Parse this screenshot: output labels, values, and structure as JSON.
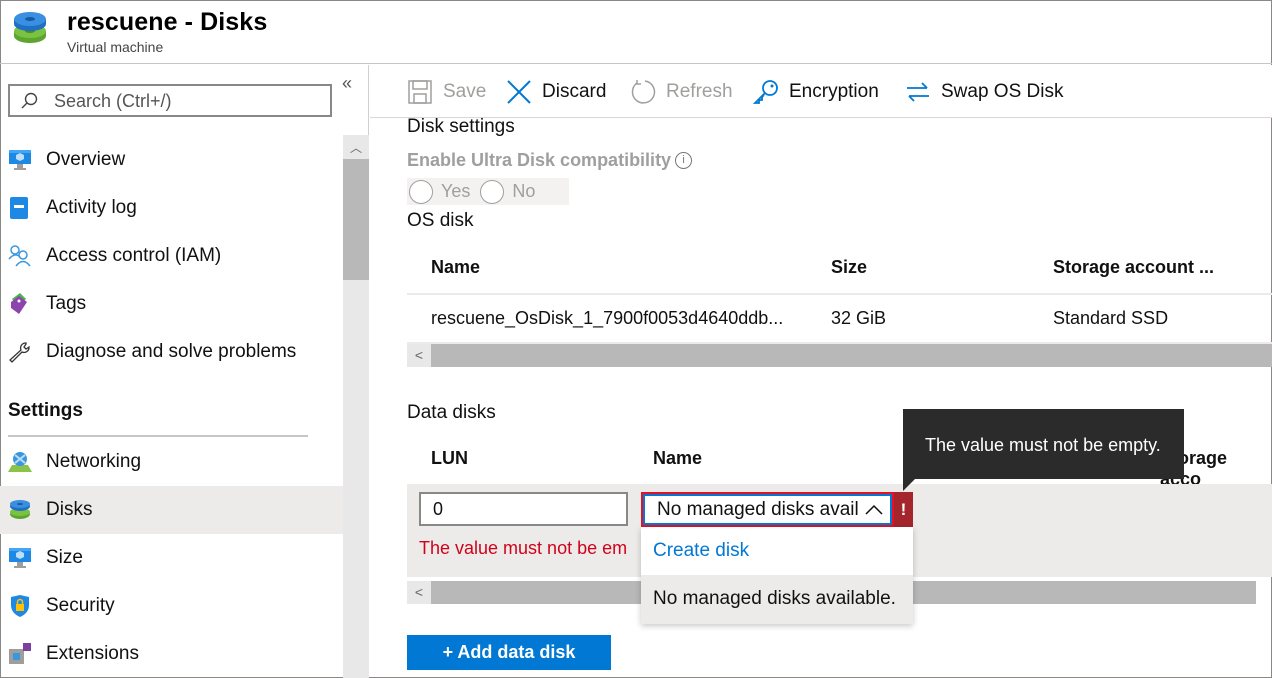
{
  "header": {
    "title": "rescuene - Disks",
    "subtitle": "Virtual machine"
  },
  "sidebar": {
    "search_placeholder": "Search (Ctrl+/)",
    "collapse_glyph": "«",
    "scroll_up_glyph": "︿",
    "items": [
      {
        "label": "Overview",
        "icon": "monitor-icon"
      },
      {
        "label": "Activity log",
        "icon": "activity-log-icon"
      },
      {
        "label": "Access control (IAM)",
        "icon": "people-icon"
      },
      {
        "label": "Tags",
        "icon": "tag-icon"
      },
      {
        "label": "Diagnose and solve problems",
        "icon": "wrench-icon"
      }
    ],
    "section_title": "Settings",
    "settings_items": [
      {
        "label": "Networking",
        "icon": "networking-icon"
      },
      {
        "label": "Disks",
        "icon": "disks-icon",
        "active": true
      },
      {
        "label": "Size",
        "icon": "monitor-icon"
      },
      {
        "label": "Security",
        "icon": "shield-lock-icon"
      },
      {
        "label": "Extensions",
        "icon": "extensions-icon"
      }
    ]
  },
  "toolbar": {
    "save": "Save",
    "discard": "Discard",
    "refresh": "Refresh",
    "encryption": "Encryption",
    "swap_os_disk": "Swap OS Disk"
  },
  "disk_settings": {
    "title": "Disk settings",
    "ultra_label": "Enable Ultra Disk compatibility",
    "info_glyph": "i",
    "options": [
      "Yes",
      "No"
    ]
  },
  "os_disk": {
    "title": "OS disk",
    "columns": [
      "Name",
      "Size",
      "Storage account ..."
    ],
    "rows": [
      {
        "name": "rescuene_OsDisk_1_7900f0053d4640ddb...",
        "size": "32 GiB",
        "storage": "Standard SSD"
      }
    ],
    "scroll_left_glyph": "<"
  },
  "data_disks": {
    "title": "Data disks",
    "columns": [
      "LUN",
      "Name",
      "Storage acco"
    ],
    "row": {
      "lun": "0",
      "name_value": "No managed disks avail",
      "error": "The value must not be em"
    },
    "error_badge": "!",
    "dropdown": {
      "create": "Create disk",
      "none": "No managed disks available."
    },
    "tooltip": "The value must not be empty.",
    "scroll_left_glyph": "<",
    "add_button": "+ Add data disk"
  },
  "colors": {
    "accent": "#0078d4",
    "error": "#d0021b",
    "error_badge": "#a4262c",
    "tooltip_bg": "#2b2b2b"
  }
}
